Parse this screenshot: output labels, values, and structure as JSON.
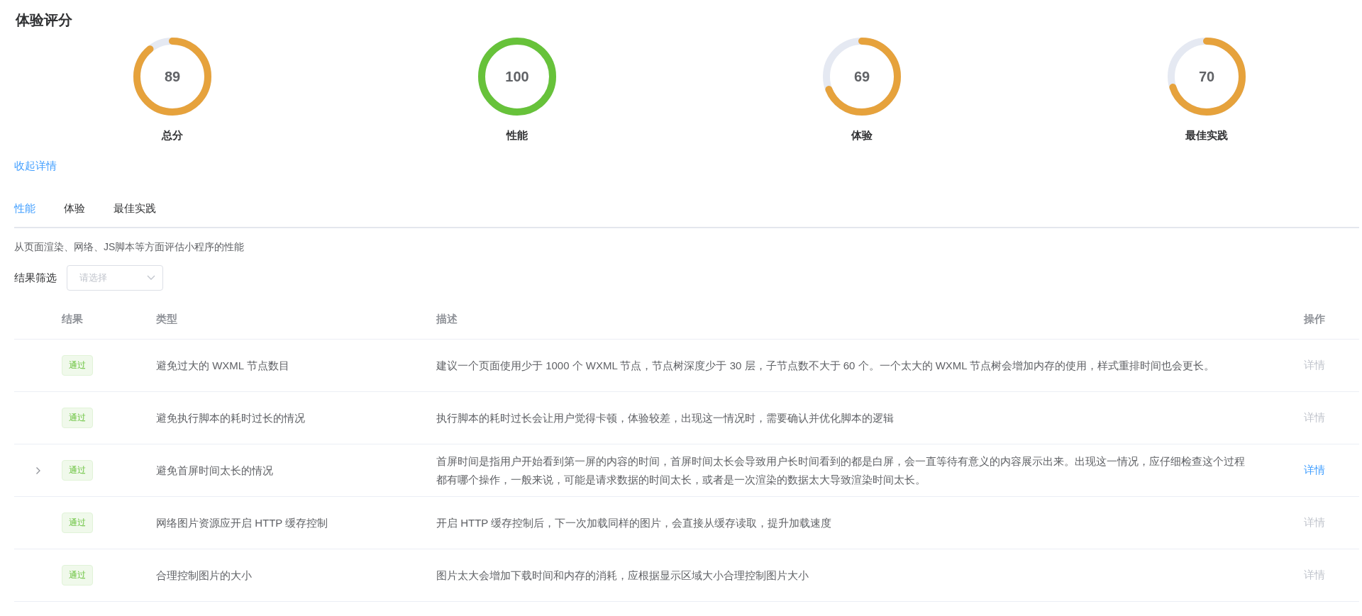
{
  "title": "体验评分",
  "gauges": [
    {
      "score": "89",
      "label": "总分",
      "level": 0.89,
      "color": "#e6a23c"
    },
    {
      "score": "100",
      "label": "性能",
      "level": 1,
      "color": "#67c23a"
    },
    {
      "score": "69",
      "label": "体验",
      "level": 0.69,
      "color": "#e6a23c"
    },
    {
      "score": "70",
      "label": "最佳实践",
      "level": 0.7,
      "color": "#e6a23c"
    }
  ],
  "collapse_link": "收起详情",
  "tabs": [
    {
      "label": "性能",
      "selected": true
    },
    {
      "label": "体验",
      "selected": false
    },
    {
      "label": "最佳实践",
      "selected": false
    }
  ],
  "description": "从页面渲染、网络、JS脚本等方面评估小程序的性能",
  "filter": {
    "label": "结果筛选",
    "placeholder": "请选择"
  },
  "table": {
    "columns": [
      "结果",
      "类型",
      "描述",
      "操作"
    ],
    "rows": [
      {
        "expandable": false,
        "result": "通过",
        "type": "避免过大的 WXML 节点数目",
        "description": "建议一个页面使用少于 1000 个 WXML 节点，节点树深度少于 30 层，子节点数不大于 60 个。一个太大的 WXML 节点树会增加内存的使用，样式重排时间也会更长。",
        "action": "详情",
        "action_enabled": false
      },
      {
        "expandable": false,
        "result": "通过",
        "type": "避免执行脚本的耗时过长的情况",
        "description": "执行脚本的耗时过长会让用户觉得卡顿，体验较差，出现这一情况时，需要确认并优化脚本的逻辑",
        "action": "详情",
        "action_enabled": false
      },
      {
        "expandable": true,
        "result": "通过",
        "type": "避免首屏时间太长的情况",
        "description": "首屏时间是指用户开始看到第一屏的内容的时间，首屏时间太长会导致用户长时间看到的都是白屏，会一直等待有意义的内容展示出来。出现这一情况，应仔细检查这个过程都有哪个操作，一般来说，可能是请求数据的时间太长，或者是一次渲染的数据太大导致渲染时间太长。",
        "action": "详情",
        "action_enabled": true
      },
      {
        "expandable": false,
        "result": "通过",
        "type": "网络图片资源应开启 HTTP 缓存控制",
        "description": "开启 HTTP 缓存控制后，下一次加载同样的图片，会直接从缓存读取，提升加载速度",
        "action": "详情",
        "action_enabled": false
      },
      {
        "expandable": false,
        "result": "通过",
        "type": "合理控制图片的大小",
        "description": "图片太大会增加下载时间和内存的消耗，应根据显示区域大小合理控制图片大小",
        "action": "详情",
        "action_enabled": false
      }
    ]
  }
}
